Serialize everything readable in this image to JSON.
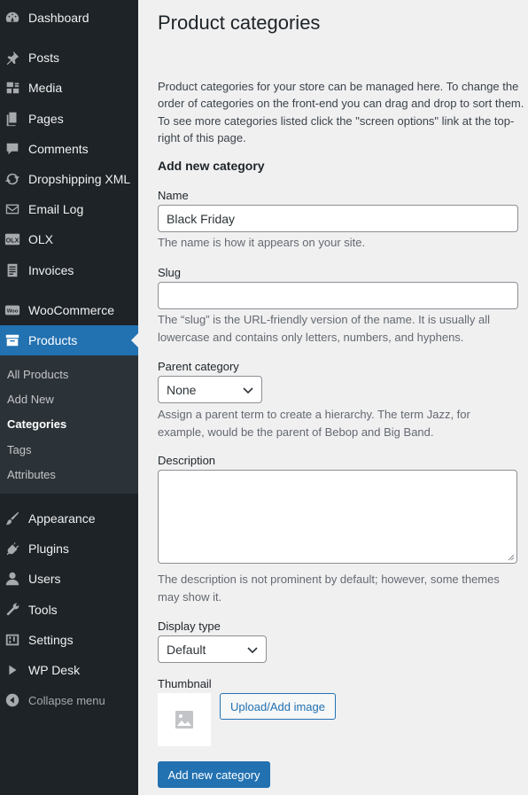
{
  "sidebar": {
    "items": [
      {
        "label": "Dashboard",
        "icon": "dashboard-icon"
      },
      {
        "label": "Posts",
        "icon": "pin-icon"
      },
      {
        "label": "Media",
        "icon": "media-icon"
      },
      {
        "label": "Pages",
        "icon": "pages-icon"
      },
      {
        "label": "Comments",
        "icon": "comment-icon"
      },
      {
        "label": "Dropshipping XML",
        "icon": "sync-icon"
      },
      {
        "label": "Email Log",
        "icon": "email-icon"
      },
      {
        "label": "OLX",
        "icon": "olx-icon"
      },
      {
        "label": "Invoices",
        "icon": "invoice-icon"
      },
      {
        "label": "WooCommerce",
        "icon": "woo-icon"
      },
      {
        "label": "Products",
        "icon": "archive-icon"
      },
      {
        "label": "Appearance",
        "icon": "brush-icon"
      },
      {
        "label": "Plugins",
        "icon": "plugin-icon"
      },
      {
        "label": "Users",
        "icon": "user-icon"
      },
      {
        "label": "Tools",
        "icon": "wrench-icon"
      },
      {
        "label": "Settings",
        "icon": "settings-icon"
      },
      {
        "label": "WP Desk",
        "icon": "play-icon"
      },
      {
        "label": "Collapse menu",
        "icon": "collapse-icon"
      }
    ],
    "submenu": [
      {
        "label": "All Products"
      },
      {
        "label": "Add New"
      },
      {
        "label": "Categories"
      },
      {
        "label": "Tags"
      },
      {
        "label": "Attributes"
      }
    ]
  },
  "main": {
    "title": "Product categories",
    "intro": "Product categories for your store can be managed here. To change the order of categories on the front-end you can drag and drop to sort them. To see more categories listed click the \"screen options\" link at the top-right of this page.",
    "section_title": "Add new category",
    "name": {
      "label": "Name",
      "value": "Black Friday",
      "help": "The name is how it appears on your site."
    },
    "slug": {
      "label": "Slug",
      "value": "",
      "help": "The “slug” is the URL-friendly version of the name. It is usually all lowercase and contains only letters, numbers, and hyphens."
    },
    "parent": {
      "label": "Parent category",
      "selected": "None",
      "help": "Assign a parent term to create a hierarchy. The term Jazz, for example, would be the parent of Bebop and Big Band."
    },
    "description": {
      "label": "Description",
      "value": "",
      "help": "The description is not prominent by default; however, some themes may show it."
    },
    "display_type": {
      "label": "Display type",
      "selected": "Default"
    },
    "thumbnail": {
      "label": "Thumbnail",
      "upload_label": "Upload/Add image"
    },
    "submit_label": "Add new category"
  },
  "colors": {
    "sidebar_bg": "#1d2327",
    "accent": "#2271b1",
    "submenu_bg": "#2c3338",
    "page_bg": "#f0f0f1"
  }
}
